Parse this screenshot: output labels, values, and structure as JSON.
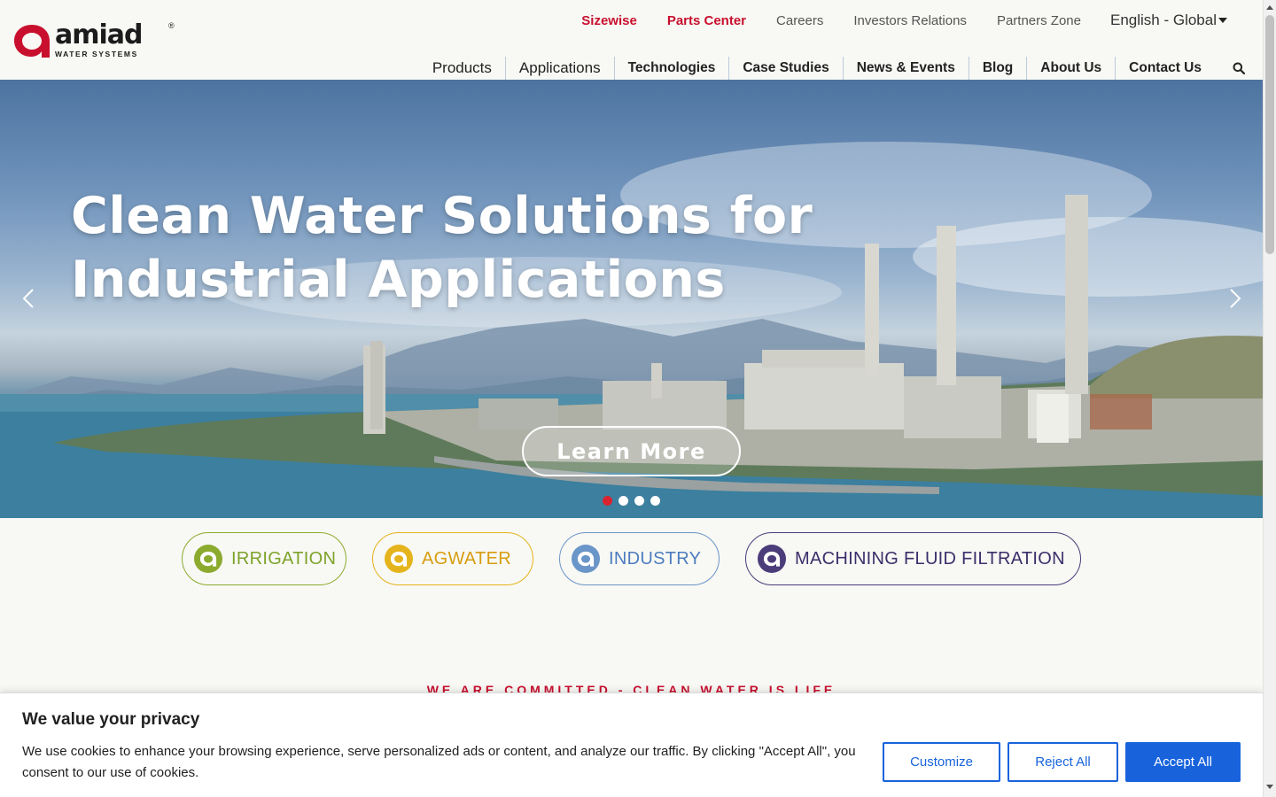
{
  "brand": {
    "name": "amiad",
    "tagline": "WATER SYSTEMS",
    "registered": "®"
  },
  "topnav": {
    "sizewise": "Sizewise",
    "parts_center": "Parts Center",
    "careers": "Careers",
    "investors": "Investors Relations",
    "partners": "Partners Zone",
    "language": "English - Global"
  },
  "mainnav": {
    "items": [
      "Products",
      "Applications",
      "Technologies",
      "Case Studies",
      "News & Events",
      "Blog",
      "About Us",
      "Contact Us"
    ]
  },
  "hero": {
    "title_line1": "Clean Water Solutions for",
    "title_line2": "Industrial Applications",
    "cta": "Learn More",
    "slides_total": 4,
    "active_slide": 1
  },
  "categories": [
    {
      "label": "IRRIGATION",
      "color": "#8cab2e"
    },
    {
      "label": "AGWATER",
      "color": "#e5b41c"
    },
    {
      "label": "INDUSTRY",
      "color": "#6a95c8"
    },
    {
      "label": "MACHINING FLUID FILTRATION",
      "color": "#4b3c7a"
    }
  ],
  "section": {
    "kicker": "WE ARE COMMITTED - CLEAN WATER IS LIFE"
  },
  "cookie": {
    "title": "We value your privacy",
    "text": "We use cookies to enhance your browsing experience, serve personalized ads or content, and analyze our traffic. By clicking \"Accept All\", you consent to our use of cookies.",
    "customize": "Customize",
    "reject": "Reject All",
    "accept": "Accept All"
  },
  "colors": {
    "brand_red": "#c8102e",
    "button_blue": "#1863dc",
    "active_dot": "#d9232e"
  },
  "icons": [
    "amiad-logo-icon",
    "caret-down-icon",
    "search-icon",
    "chevron-left-icon",
    "chevron-right-icon"
  ]
}
